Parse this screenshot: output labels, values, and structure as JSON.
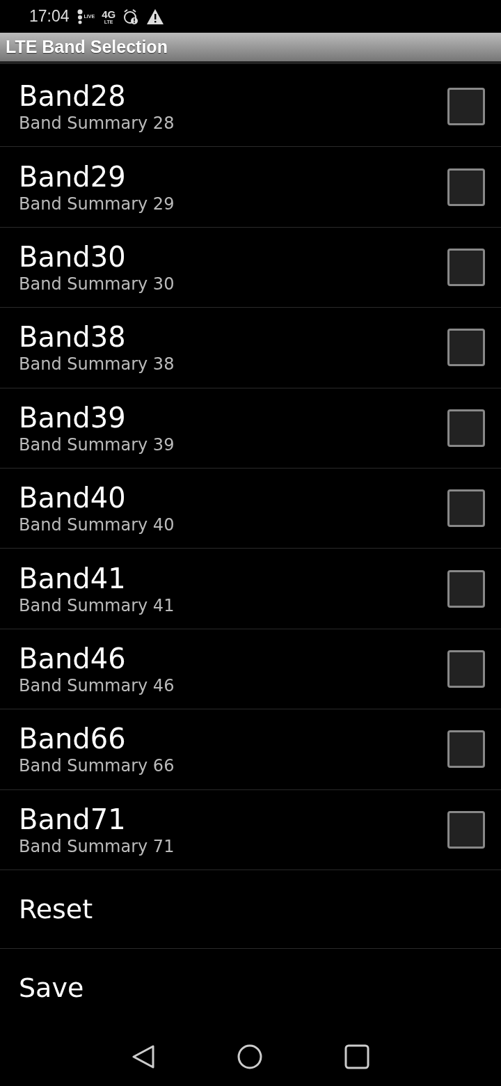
{
  "status_bar": {
    "time": "17:04",
    "live_label": "LIVE",
    "network": "4G",
    "network_sub": "LTE"
  },
  "title_bar": {
    "title": "LTE Band Selection"
  },
  "bands": [
    {
      "name": "Band28",
      "summary": "Band Summary 28",
      "checked": false
    },
    {
      "name": "Band29",
      "summary": "Band Summary 29",
      "checked": false
    },
    {
      "name": "Band30",
      "summary": "Band Summary 30",
      "checked": false
    },
    {
      "name": "Band38",
      "summary": "Band Summary 38",
      "checked": false
    },
    {
      "name": "Band39",
      "summary": "Band Summary 39",
      "checked": false
    },
    {
      "name": "Band40",
      "summary": "Band Summary 40",
      "checked": false
    },
    {
      "name": "Band41",
      "summary": "Band Summary 41",
      "checked": false
    },
    {
      "name": "Band46",
      "summary": "Band Summary 46",
      "checked": false
    },
    {
      "name": "Band66",
      "summary": "Band Summary 66",
      "checked": false
    },
    {
      "name": "Band71",
      "summary": "Band Summary 71",
      "checked": false
    }
  ],
  "actions": [
    "Reset",
    "Save"
  ]
}
